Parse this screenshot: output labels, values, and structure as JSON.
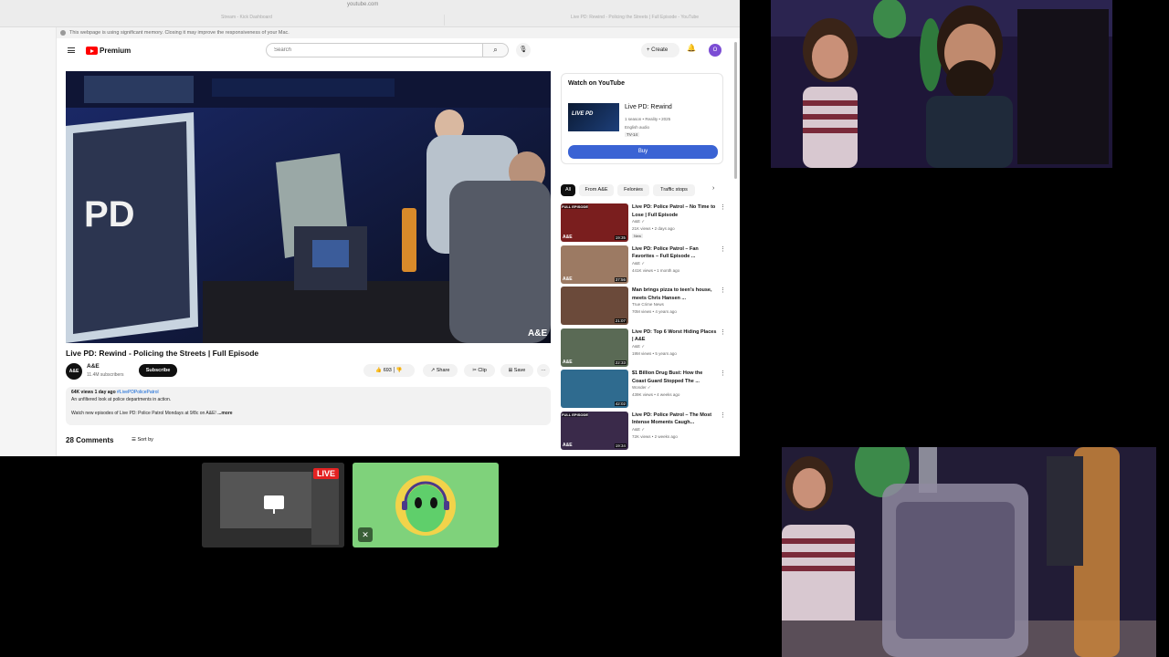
{
  "browser": {
    "url": "youtube.com",
    "tab_left": "Stream - Kick Dashboard",
    "tab_right": "Live PD: Rewind - Policing the Streets | Full Episode - YouTube",
    "memory_warning": "This webpage is using significant memory. Closing it may improve the responsiveness of your Mac."
  },
  "youtube": {
    "brand": "Premium",
    "search_placeholder": "Search",
    "create_label": "+ Create",
    "avatar_letter": "O",
    "video": {
      "title": "Live PD: Rewind - Policing the Streets | Full Episode",
      "overlay_text": "PD",
      "watermark": "A&E"
    },
    "channel": {
      "avatar_text": "A&E",
      "name": "A&E",
      "subscribers": "11.4M subscribers",
      "subscribe_label": "Subscribe"
    },
    "actions": {
      "likes": "693",
      "share": "Share",
      "clip": "Clip",
      "save": "Save",
      "more": "···"
    },
    "description": {
      "stats": "64K views  1 day ago",
      "hashtag": "#LivePDPolicePatrol",
      "line1": "An unfiltered look at police departments in action.",
      "line2": "Watch new episodes of Live PD: Police Patrol Mondays at 9/8c on A&E! ",
      "more": "...more"
    },
    "comments": {
      "count_label": "28 Comments",
      "sort_label": "Sort by"
    },
    "watch_card": {
      "heading": "Watch on YouTube",
      "thumb_text": "LIVE PD",
      "title": "Live PD: Rewind",
      "meta1": "1 season • Reality • 2025",
      "meta2": "English audio",
      "rating": "TV-14",
      "buy_label": "Buy"
    },
    "chips": [
      "All",
      "From A&E",
      "Felonies",
      "Traffic stops"
    ],
    "recommendations": [
      {
        "title": "Live PD: Police Patrol – No Time to Lose | Full Episode",
        "channel": "A&E ✓",
        "meta": "21K views • 2 days ago",
        "badge": "New",
        "duration": "19:35",
        "banner": "FULL EPISODE",
        "logo": "A&E",
        "thumb_color": "#7a1e1e"
      },
      {
        "title": "Live PD: Police Patrol – Fan Favorites – Full Episode ...",
        "channel": "A&E ✓",
        "meta": "441K views • 1 month ago",
        "badge": "",
        "duration": "37:56",
        "banner": "",
        "logo": "A&E",
        "thumb_color": "#9c7a63"
      },
      {
        "title": "Man brings pizza to teen's house, meets Chris Hansen ...",
        "channel": "True Crime News",
        "meta": "70M views • 4 years ago",
        "badge": "",
        "duration": "21:07",
        "banner": "",
        "logo": "",
        "thumb_color": "#6b4a3a"
      },
      {
        "title": "Live PD: Top 6 Worst Hiding Places | A&E",
        "channel": "A&E ✓",
        "meta": "19M views • 5 years ago",
        "badge": "",
        "duration": "22:33",
        "banner": "",
        "logo": "A&E",
        "thumb_color": "#5a6a55"
      },
      {
        "title": "$1 Billion Drug Bust: How the Coast Guard Stopped The ...",
        "channel": "Wonder ✓",
        "meta": "439K views • 4 weeks ago",
        "badge": "",
        "duration": "42:02",
        "banner": "",
        "logo": "",
        "thumb_color": "#2f6b8f"
      },
      {
        "title": "Live PD: Police Patrol – The Most Intense Moments Caugh...",
        "channel": "A&E ✓",
        "meta": "72K views • 2 weeks ago",
        "badge": "",
        "duration": "19:34",
        "banner": "FULL EPISODE",
        "logo": "A&E",
        "thumb_color": "#3a2a4a"
      }
    ]
  },
  "tiles": {
    "screen_live_badge": "LIVE",
    "mute_icon": "mic-off-icon"
  },
  "colors": {
    "youtube_red": "#ff0000",
    "buy_blue": "#3a63d4",
    "live_red": "#e32222",
    "avatar_tile_green": "#7fd27b"
  }
}
